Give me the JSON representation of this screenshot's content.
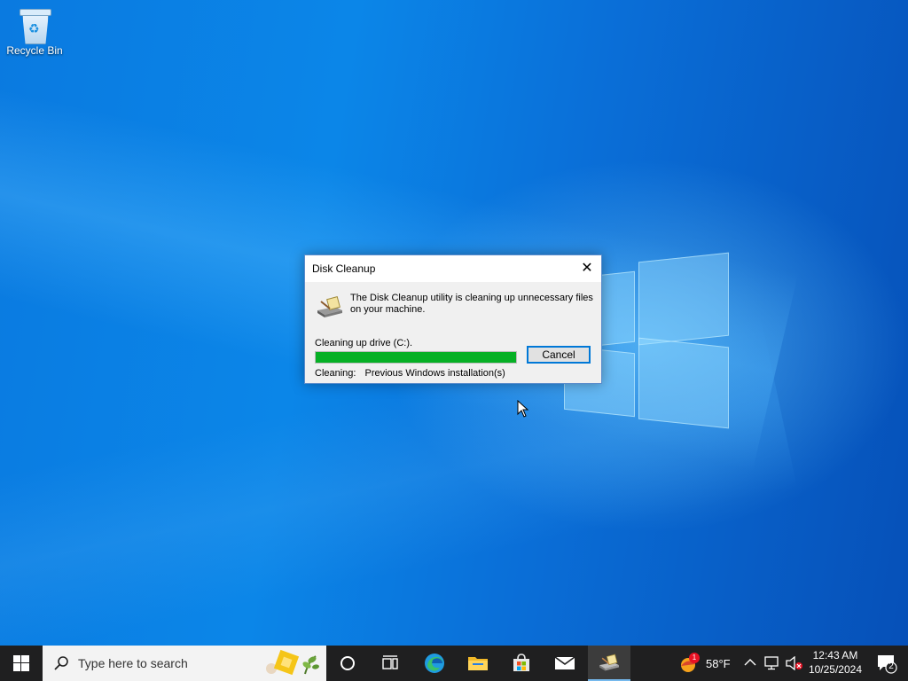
{
  "desktop": {
    "recycle_bin_label": "Recycle Bin"
  },
  "dialog": {
    "title": "Disk Cleanup",
    "close_glyph": "✕",
    "message": "The Disk Cleanup utility is cleaning up unnecessary files on your machine.",
    "drive_text": "Cleaning up drive  (C:).",
    "progress_fraction": 1.0,
    "cancel_label": "Cancel",
    "cleaning_label": "Cleaning:",
    "cleaning_value": "Previous Windows installation(s)"
  },
  "taskbar": {
    "search_placeholder": "Type here to search",
    "pinned": [
      "cortana-icon",
      "task-view-icon",
      "edge-icon",
      "file-explorer-icon",
      "store-icon",
      "mail-icon",
      "disk-cleanup-icon"
    ],
    "weather": {
      "temp": "58°F",
      "badge": "1"
    },
    "clock": {
      "time": "12:43 AM",
      "date": "10/25/2024"
    },
    "notification_count": "2"
  },
  "colors": {
    "progress": "#06b025",
    "accent": "#0078d7",
    "taskbar": "#1f1f20"
  }
}
